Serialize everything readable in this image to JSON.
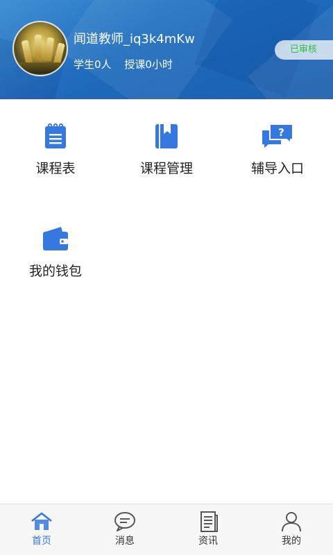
{
  "header": {
    "username": "闻道教师_iq3k4mKw",
    "students": "学生0人",
    "hours": "授课0小时",
    "status_badge": "已审核"
  },
  "menu": [
    {
      "label": "课程表",
      "icon": "schedule-icon"
    },
    {
      "label": "课程管理",
      "icon": "course-book-icon"
    },
    {
      "label": "辅导入口",
      "icon": "tutoring-chat-icon"
    },
    {
      "label": "我的钱包",
      "icon": "wallet-icon"
    }
  ],
  "bottom_nav": [
    {
      "label": "首页",
      "icon": "home-icon",
      "active": true
    },
    {
      "label": "消息",
      "icon": "message-icon",
      "active": false
    },
    {
      "label": "资讯",
      "icon": "news-icon",
      "active": false
    },
    {
      "label": "我的",
      "icon": "profile-icon",
      "active": false
    }
  ],
  "colors": {
    "accent": "#3478e0",
    "header": "#1e6bbd",
    "badge_text": "#2fbf3e"
  }
}
